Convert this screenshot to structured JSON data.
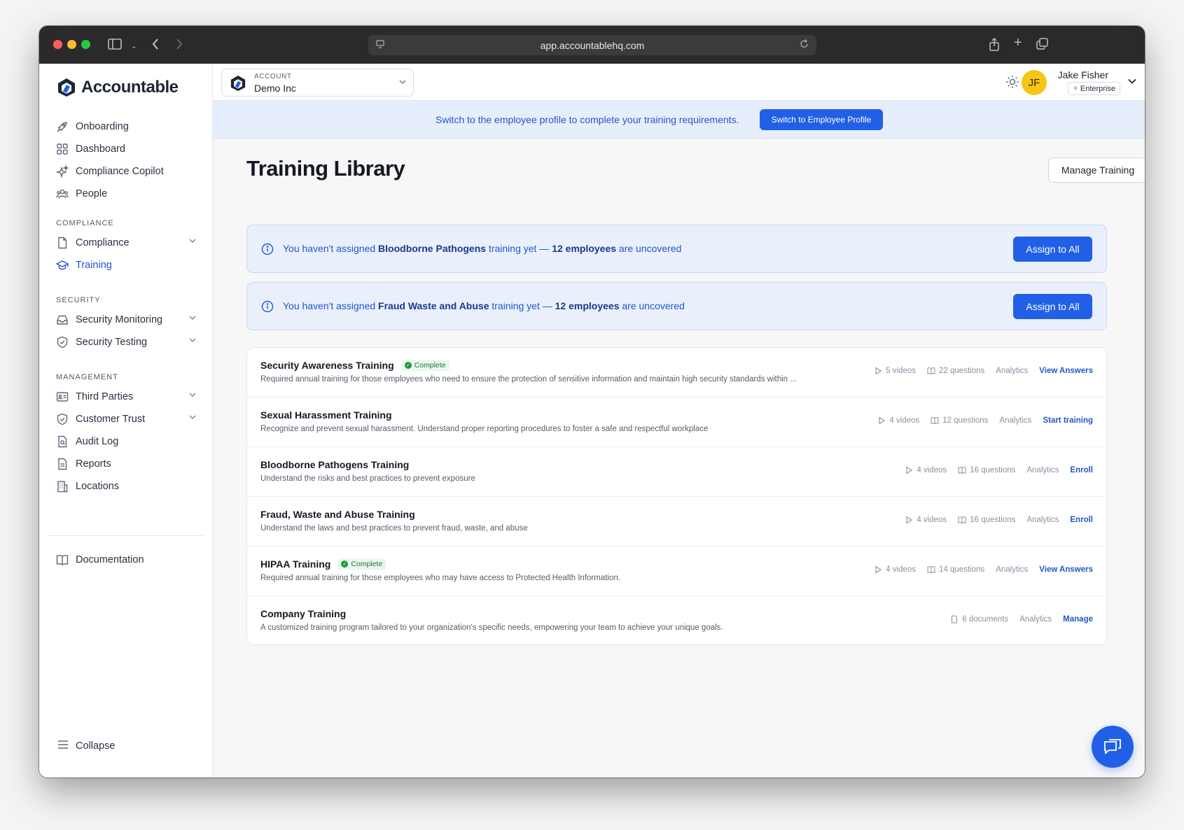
{
  "browser": {
    "url": "app.accountablehq.com"
  },
  "app": {
    "name": "Accountable"
  },
  "sidebar": {
    "items_top": [
      {
        "label": "Onboarding",
        "icon": "rocket-icon"
      },
      {
        "label": "Dashboard",
        "icon": "grid-icon"
      },
      {
        "label": "Compliance Copilot",
        "icon": "sparkle-icon"
      },
      {
        "label": "People",
        "icon": "people-icon"
      }
    ],
    "compliance_label": "COMPLIANCE",
    "compliance_items": [
      {
        "label": "Compliance",
        "icon": "document-icon"
      },
      {
        "label": "Training",
        "icon": "graduation-cap-icon"
      }
    ],
    "security_label": "SECURITY",
    "security_items": [
      {
        "label": "Security Monitoring",
        "icon": "inbox-icon"
      },
      {
        "label": "Security Testing",
        "icon": "shield-check-icon"
      }
    ],
    "management_label": "MANAGEMENT",
    "management_items": [
      {
        "label": "Third Parties",
        "icon": "id-card-icon"
      },
      {
        "label": "Customer Trust",
        "icon": "shield-check-icon"
      },
      {
        "label": "Audit Log",
        "icon": "file-search-icon"
      },
      {
        "label": "Reports",
        "icon": "file-icon"
      },
      {
        "label": "Locations",
        "icon": "building-icon"
      }
    ],
    "documentation": "Documentation",
    "collapse": "Collapse"
  },
  "topbar": {
    "account_label": "ACCOUNT",
    "account_name": "Demo Inc",
    "avatar_initials": "JF",
    "user_name": "Jake Fisher",
    "user_plan": "Enterprise"
  },
  "banner": {
    "text": "Switch to the employee profile to complete your training requirements.",
    "button": "Switch to Employee Profile"
  },
  "page": {
    "title": "Training Library",
    "manage_button": "Manage Training"
  },
  "alerts": [
    {
      "prefix": "You haven't assigned ",
      "training": "Bloodborne Pathogens",
      "middle": " training yet — ",
      "count": "12 employees",
      "suffix": " are uncovered",
      "button": "Assign to All"
    },
    {
      "prefix": "You haven't assigned ",
      "training": "Fraud Waste and Abuse",
      "middle": " training yet — ",
      "count": "12 employees",
      "suffix": " are uncovered",
      "button": "Assign to All"
    }
  ],
  "trainings": [
    {
      "title": "Security Awareness Training",
      "badge": "Complete",
      "description": "Required annual training for those employees who need to ensure the protection of sensitive information and maintain high security standards within ...",
      "videos": "5 videos",
      "questions": "22 questions",
      "analytics": "Analytics",
      "action": "View Answers"
    },
    {
      "title": "Sexual Harassment Training",
      "badge": "",
      "description": "Recognize and prevent sexual harassment. Understand proper reporting procedures to foster a safe and respectful workplace",
      "videos": "4 videos",
      "questions": "12 questions",
      "analytics": "Analytics",
      "action": "Start training"
    },
    {
      "title": "Bloodborne Pathogens Training",
      "badge": "",
      "description": "Understand the risks and best practices to prevent exposure",
      "videos": "4 videos",
      "questions": "16 questions",
      "analytics": "Analytics",
      "action": "Enroll"
    },
    {
      "title": "Fraud, Waste and Abuse Training",
      "badge": "",
      "description": "Understand the laws and best practices to prevent fraud, waste, and abuse",
      "videos": "4 videos",
      "questions": "16 questions",
      "analytics": "Analytics",
      "action": "Enroll"
    },
    {
      "title": "HIPAA Training",
      "badge": "Complete",
      "description": "Required annual training for those employees who may have access to Protected Health Information.",
      "videos": "4 videos",
      "questions": "14 questions",
      "analytics": "Analytics",
      "action": "View Answers"
    },
    {
      "title": "Company Training",
      "badge": "",
      "description": "A customized training program tailored to your organization's specific needs, empowering your team to achieve your unique goals.",
      "documents": "6 documents",
      "analytics": "Analytics",
      "action": "Manage"
    }
  ],
  "colors": {
    "accent": "#2160e6",
    "link": "#2256c9",
    "complete": "#1f9a43"
  }
}
